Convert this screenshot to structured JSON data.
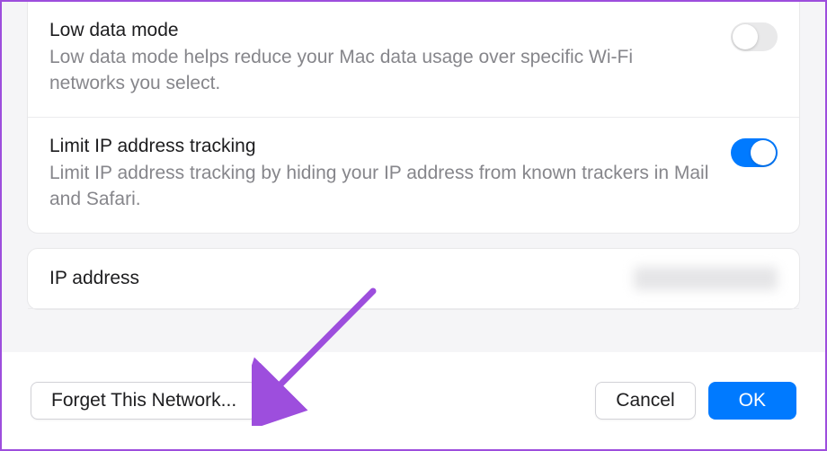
{
  "settings": {
    "lowData": {
      "title": "Low data mode",
      "desc": "Low data mode helps reduce your Mac data usage over specific Wi-Fi networks you select.",
      "enabled": false
    },
    "limitIP": {
      "title": "Limit IP address tracking",
      "desc": "Limit IP address tracking by hiding your IP address from known trackers in Mail and Safari.",
      "enabled": true
    },
    "ipAddress": {
      "label": "IP address"
    }
  },
  "buttons": {
    "forget": "Forget This Network...",
    "cancel": "Cancel",
    "ok": "OK"
  }
}
